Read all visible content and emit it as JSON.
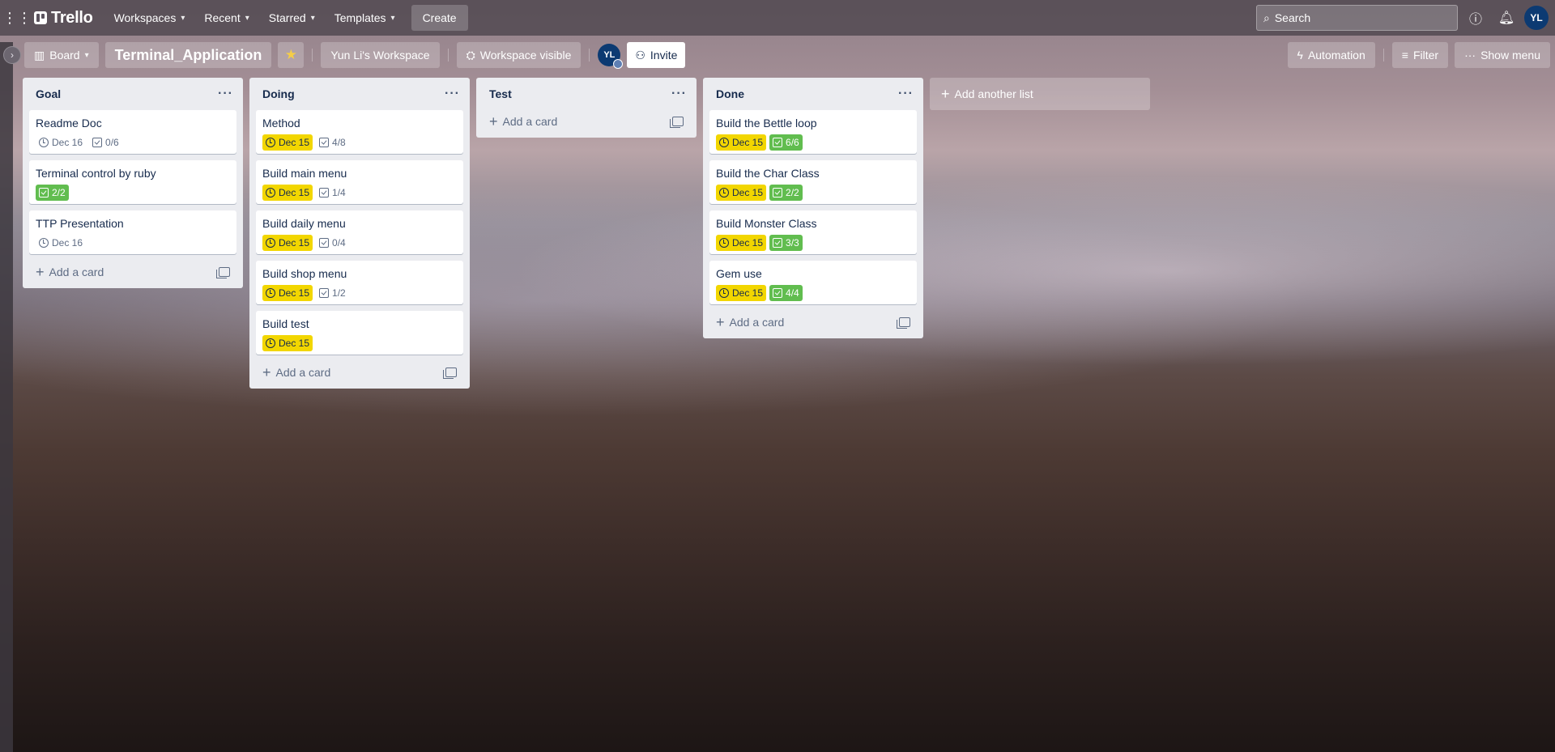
{
  "header": {
    "app_name": "Trello",
    "nav": [
      "Workspaces",
      "Recent",
      "Starred",
      "Templates"
    ],
    "create_label": "Create",
    "search_placeholder": "Search",
    "avatar_initials": "YL"
  },
  "board": {
    "view_label": "Board",
    "title": "Terminal_Application",
    "workspace_name": "Yun Li's Workspace",
    "visibility_label": "Workspace visible",
    "member_initials": "YL",
    "invite_label": "Invite",
    "automation_label": "Automation",
    "filter_label": "Filter",
    "show_menu_label": "Show menu"
  },
  "lists": [
    {
      "title": "Goal",
      "cards": [
        {
          "title": "Readme Doc",
          "due": "Dec 16",
          "due_state": "normal",
          "checklist": "0/6",
          "checklist_state": "normal"
        },
        {
          "title": "Terminal control by ruby",
          "due": null,
          "checklist": "2/2",
          "checklist_state": "done"
        },
        {
          "title": "TTP Presentation",
          "due": "Dec 16",
          "due_state": "normal",
          "checklist": null
        }
      ]
    },
    {
      "title": "Doing",
      "cards": [
        {
          "title": "Method",
          "due": "Dec 15",
          "due_state": "soon",
          "checklist": "4/8",
          "checklist_state": "normal"
        },
        {
          "title": "Build main menu",
          "due": "Dec 15",
          "due_state": "soon",
          "checklist": "1/4",
          "checklist_state": "normal"
        },
        {
          "title": "Build daily menu",
          "due": "Dec 15",
          "due_state": "soon",
          "checklist": "0/4",
          "checklist_state": "normal"
        },
        {
          "title": "Build shop menu",
          "due": "Dec 15",
          "due_state": "soon",
          "checklist": "1/2",
          "checklist_state": "normal"
        },
        {
          "title": "Build test",
          "due": "Dec 15",
          "due_state": "soon",
          "checklist": null
        }
      ]
    },
    {
      "title": "Test",
      "cards": []
    },
    {
      "title": "Done",
      "cards": [
        {
          "title": "Build the Bettle loop",
          "due": "Dec 15",
          "due_state": "soon",
          "checklist": "6/6",
          "checklist_state": "done"
        },
        {
          "title": "Build the Char Class",
          "due": "Dec 15",
          "due_state": "soon",
          "checklist": "2/2",
          "checklist_state": "done"
        },
        {
          "title": "Build Monster Class",
          "due": "Dec 15",
          "due_state": "soon",
          "checklist": "3/3",
          "checklist_state": "done"
        },
        {
          "title": "Gem use",
          "due": "Dec 15",
          "due_state": "soon",
          "checklist": "4/4",
          "checklist_state": "done"
        }
      ]
    }
  ],
  "add_card_label": "Add a card",
  "add_list_label": "Add another list",
  "colors": {
    "due_soon": "#f2d600",
    "checklist_done": "#61bd4f",
    "list_bg": "#ebecf0",
    "avatar": "#0c3a72"
  }
}
